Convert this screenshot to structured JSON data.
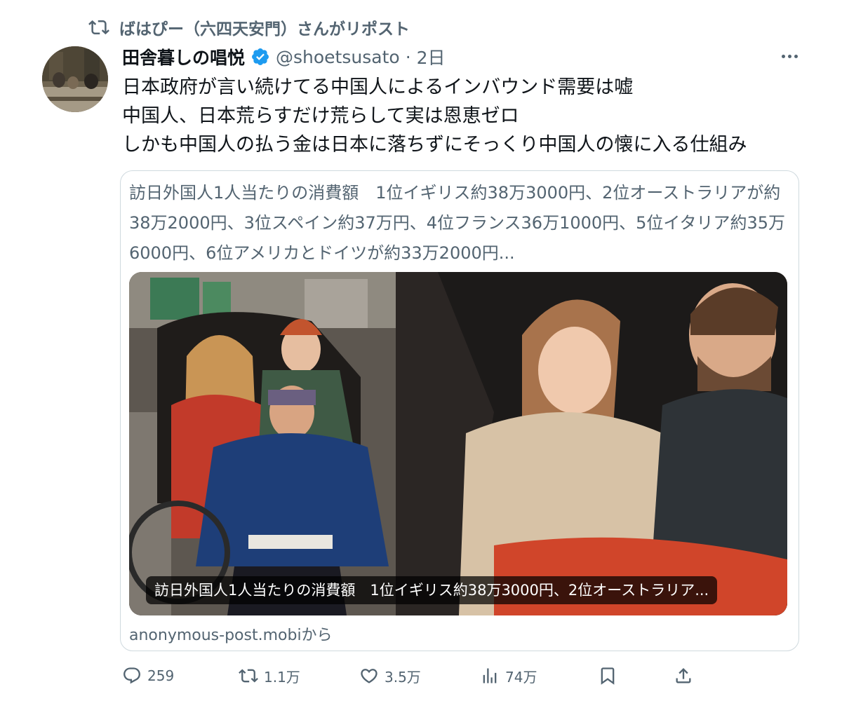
{
  "repost_line": "ばはぴー（六四天安門）さんがリポスト",
  "author": {
    "display_name": "田舎暮しの唱悦",
    "handle": "@shoetsusato",
    "separator": "·",
    "time": "2日"
  },
  "body_lines": [
    "日本政府が言い続けてる中国人によるインバウンド需要は嘘",
    "中国人、日本荒らすだけ荒らして実は恩恵ゼロ",
    "しかも中国人の払う金は日本に落ちずにそっくり中国人の懐に入る仕組み"
  ],
  "card": {
    "description": "訪日外国人1人当たりの消費額　1位イギリス約38万3000円、2位オーストラリアが約38万2000円、3位スペイン約37万円、4位フランス36万1000円、5位イタリア約35万6000円、6位アメリカとドイツが約33万2000円...",
    "image_caption": "訪日外国人1人当たりの消費額　1位イギリス約38万3000円、2位オーストラリア...",
    "domain": "anonymous-post.mobiから"
  },
  "actions": {
    "replies": "259",
    "reposts": "1.1万",
    "likes": "3.5万",
    "views": "74万"
  },
  "icons": {
    "repost": "repost-icon",
    "verified": "verified-badge-icon",
    "more": "more-icon",
    "reply": "reply-icon",
    "like": "heart-icon",
    "views": "views-icon",
    "bookmark": "bookmark-icon",
    "share": "share-icon"
  },
  "colors": {
    "text_primary": "#0f1419",
    "text_secondary": "#536471",
    "verified_blue": "#1d9bf0",
    "border": "#cfd9de"
  }
}
